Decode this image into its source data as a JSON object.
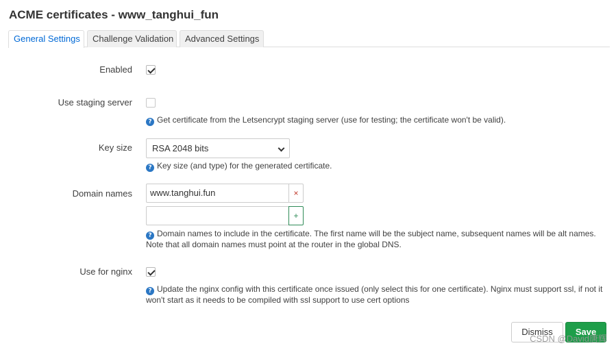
{
  "modal": {
    "title": "ACME certificates - www_tanghui_fun"
  },
  "tabs": [
    {
      "label": "General Settings",
      "active": true
    },
    {
      "label": "Challenge Validation",
      "active": false
    },
    {
      "label": "Advanced Settings",
      "active": false
    }
  ],
  "fields": {
    "enabled": {
      "label": "Enabled",
      "checked": true
    },
    "staging": {
      "label": "Use staging server",
      "checked": false,
      "help": "Get certificate from the Letsencrypt staging server (use for testing; the certificate won't be valid)."
    },
    "keysize": {
      "label": "Key size",
      "value": "RSA 2048 bits",
      "help": "Key size (and type) for the generated certificate."
    },
    "domains": {
      "label": "Domain names",
      "values": [
        "www.tanghui.fun",
        ""
      ],
      "remove_symbol": "×",
      "add_symbol": "+",
      "help": "Domain names to include in the certificate. The first name will be the subject name, subsequent names will be alt names. Note that all domain names must point at the router in the global DNS."
    },
    "nginx": {
      "label": "Use for nginx",
      "checked": true,
      "help": "Update the nginx config with this certificate once issued (only select this for one certificate). Nginx must support ssl, if not it won't start as it needs to be compiled with ssl support to use cert options"
    }
  },
  "help_icon_glyph": "?",
  "footer": {
    "dismiss_label": "Dismiss",
    "save_label": "Save"
  },
  "watermark": "CSDN @David唐辉",
  "colors": {
    "active_tab": "#0069d6",
    "save_button": "#1e9e4a",
    "help_icon": "#2b77c4"
  }
}
